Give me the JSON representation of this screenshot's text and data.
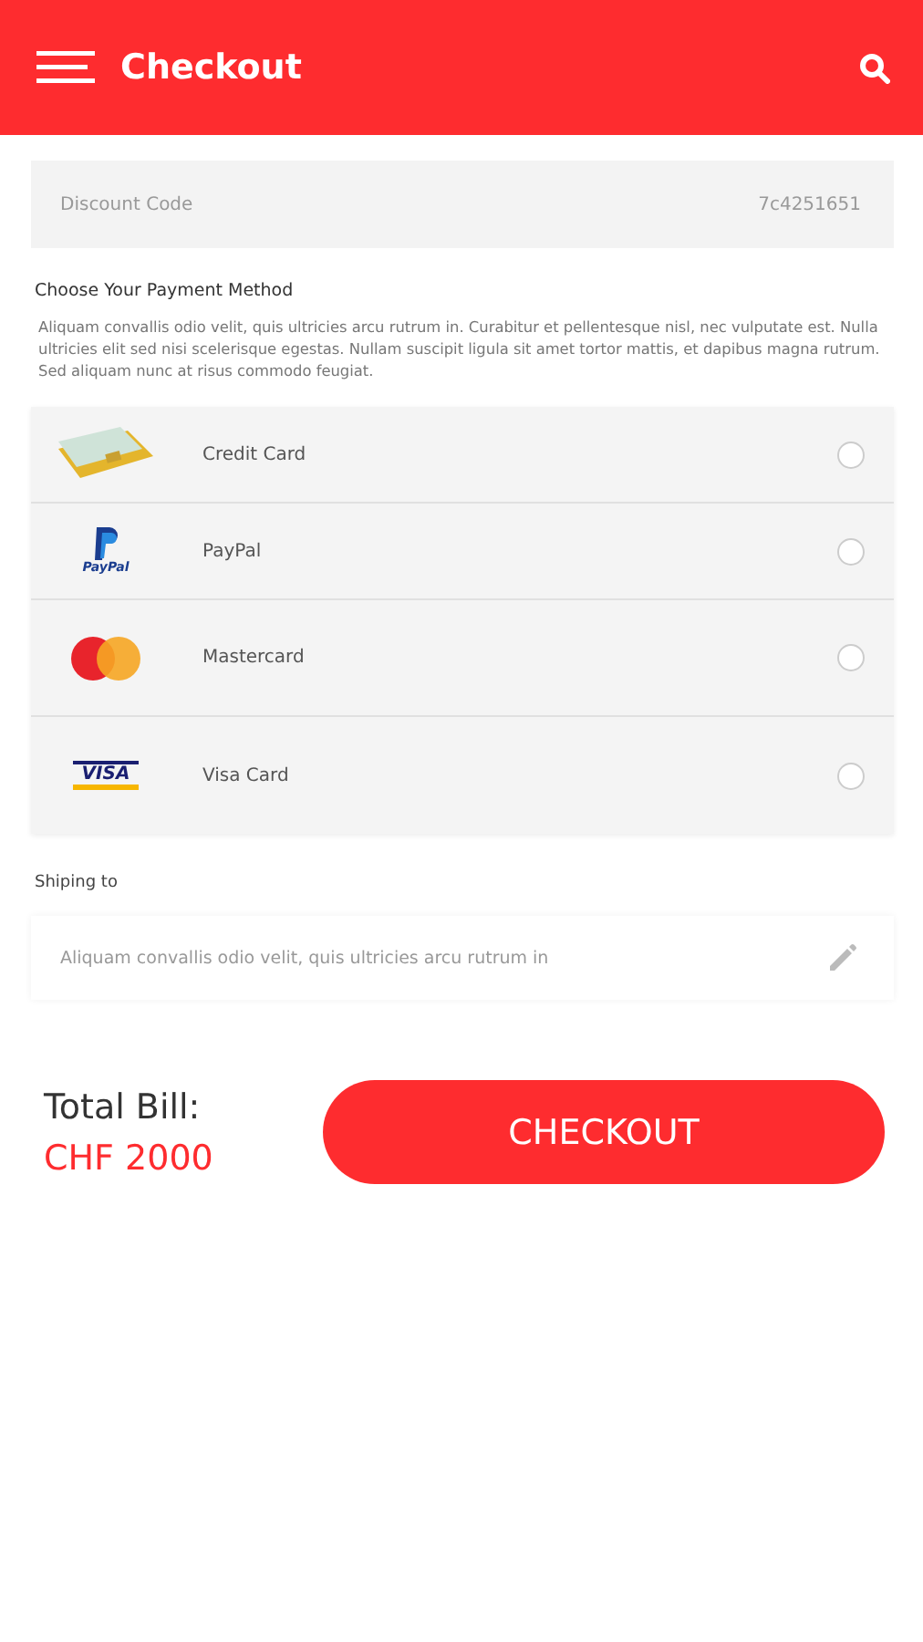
{
  "header": {
    "title": "Checkout"
  },
  "discount": {
    "label": "Discount Code",
    "value": "7c4251651"
  },
  "payment": {
    "heading": "Choose Your Payment Method",
    "description": "Aliquam convallis odio velit, quis ultricies arcu rutrum in. Curabitur et pellentesque nisl, nec vulputate est. Nulla ultricies elit sed nisi scelerisque egestas. Nullam suscipit ligula sit amet tortor mattis, et dapibus magna rutrum. Sed aliquam nunc at risus commodo feugiat.",
    "methods": [
      {
        "kind": "card",
        "label": "Credit Card",
        "selected": false
      },
      {
        "kind": "paypal",
        "label": "PayPal",
        "logo_text": "PayPal",
        "selected": false
      },
      {
        "kind": "mastercard",
        "label": "Mastercard",
        "selected": false
      },
      {
        "kind": "visa",
        "label": "Visa Card",
        "logo_text": "VISA",
        "selected": false
      }
    ]
  },
  "shipping": {
    "label": "Shiping to",
    "address": "Aliquam convallis odio velit, quis ultricies arcu rutrum in"
  },
  "total": {
    "label": "Total Bill:",
    "amount": "CHF 2000"
  },
  "checkout_button": "CHECKOUT"
}
